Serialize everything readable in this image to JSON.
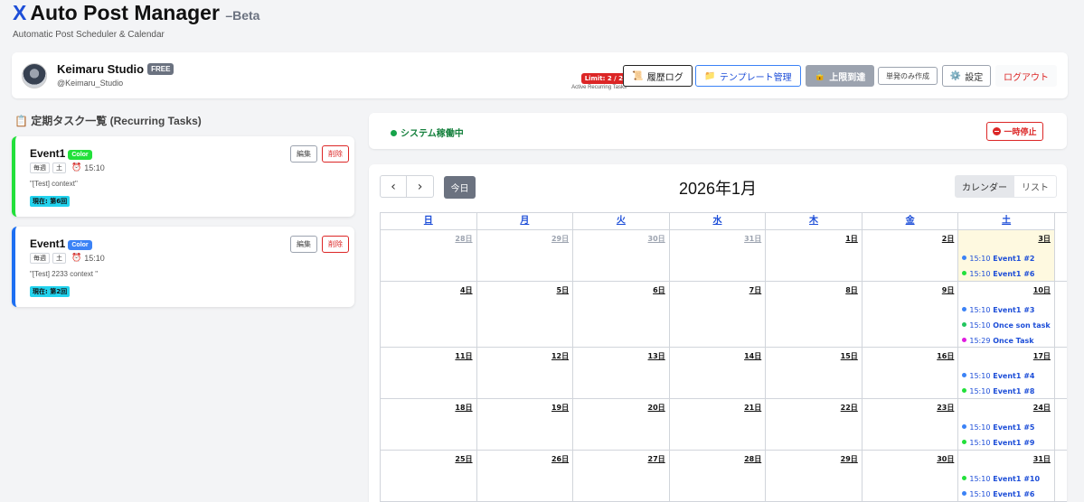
{
  "app": {
    "logo": "X",
    "title": "Auto Post Manager",
    "beta": "–Beta",
    "subtitle": "Automatic Post Scheduler & Calendar"
  },
  "profile": {
    "name": "Keimaru Studio",
    "plan": "FREE",
    "handle": "@Keimaru_Studio"
  },
  "limit": {
    "badge": "Limit: 2 / 2",
    "sub": "Active Recurring Tasks"
  },
  "toolbar": {
    "history": "履歴ログ",
    "history_icon": "📜",
    "template": "テンプレート管理",
    "template_icon": "📁",
    "limit_reached": "上限到達",
    "lock_icon": "🔒",
    "single": "単発のみ作成",
    "settings": "設定",
    "gear_icon": "⚙️",
    "logout": "ログアウト"
  },
  "section": {
    "icon": "📋",
    "title": "定期タスク一覧 (Recurring Tasks)"
  },
  "tasks": [
    {
      "name": "Event1",
      "color_label": "Color",
      "color": "#22e03a",
      "freq": "毎週",
      "day": "土",
      "alarm": "⏰",
      "time": "15:10",
      "content": "\"[Test] context\"",
      "current": "現在: 第6回",
      "edit": "編集",
      "delete": "削除"
    },
    {
      "name": "Event1",
      "color_label": "Color",
      "color": "#3b82f6",
      "freq": "毎週",
      "day": "土",
      "alarm": "⏰",
      "time": "15:10",
      "content": "\"[Test] 2233 context \"",
      "current": "現在: 第2回",
      "edit": "編集",
      "delete": "削除"
    }
  ],
  "status": {
    "text": "システム稼働中",
    "pause": "一時停止"
  },
  "calendar": {
    "prev": "‹",
    "next": "›",
    "today": "今日",
    "title": "2026年1月",
    "view_calendar": "カレンダー",
    "view_list": "リスト",
    "dow": [
      "日",
      "月",
      "火",
      "水",
      "木",
      "金",
      "土"
    ],
    "weeks": [
      [
        "28日",
        "29日",
        "30日",
        "31日",
        "1日",
        "2日",
        "3日"
      ],
      [
        "4日",
        "5日",
        "6日",
        "7日",
        "8日",
        "9日",
        "10日"
      ],
      [
        "11日",
        "12日",
        "13日",
        "14日",
        "15日",
        "16日",
        "17日"
      ],
      [
        "18日",
        "19日",
        "20日",
        "21日",
        "22日",
        "23日",
        "24日"
      ],
      [
        "25日",
        "26日",
        "27日",
        "28日",
        "29日",
        "30日",
        "31日"
      ]
    ],
    "events": {
      "w0": [
        {
          "time": "15:10",
          "title": "Event1 #2",
          "color": "#3b82f6"
        },
        {
          "time": "15:10",
          "title": "Event1 #6",
          "color": "#22e03a"
        }
      ],
      "w1": [
        {
          "time": "15:10",
          "title": "Event1 #3",
          "color": "#3b82f6"
        },
        {
          "time": "15:10",
          "title": "Once son task",
          "color": "#22c55e"
        },
        {
          "time": "15:29",
          "title": "Once Task",
          "color": "#e01ce0"
        }
      ],
      "w2": [
        {
          "time": "15:10",
          "title": "Event1 #4",
          "color": "#3b82f6"
        },
        {
          "time": "15:10",
          "title": "Event1 #8",
          "color": "#22e03a"
        }
      ],
      "w3": [
        {
          "time": "15:10",
          "title": "Event1 #5",
          "color": "#3b82f6"
        },
        {
          "time": "15:10",
          "title": "Event1 #9",
          "color": "#22e03a"
        }
      ],
      "w4": [
        {
          "time": "15:10",
          "title": "Event1 #10",
          "color": "#22e03a"
        },
        {
          "time": "15:10",
          "title": "Event1 #6",
          "color": "#3b82f6"
        }
      ]
    }
  }
}
